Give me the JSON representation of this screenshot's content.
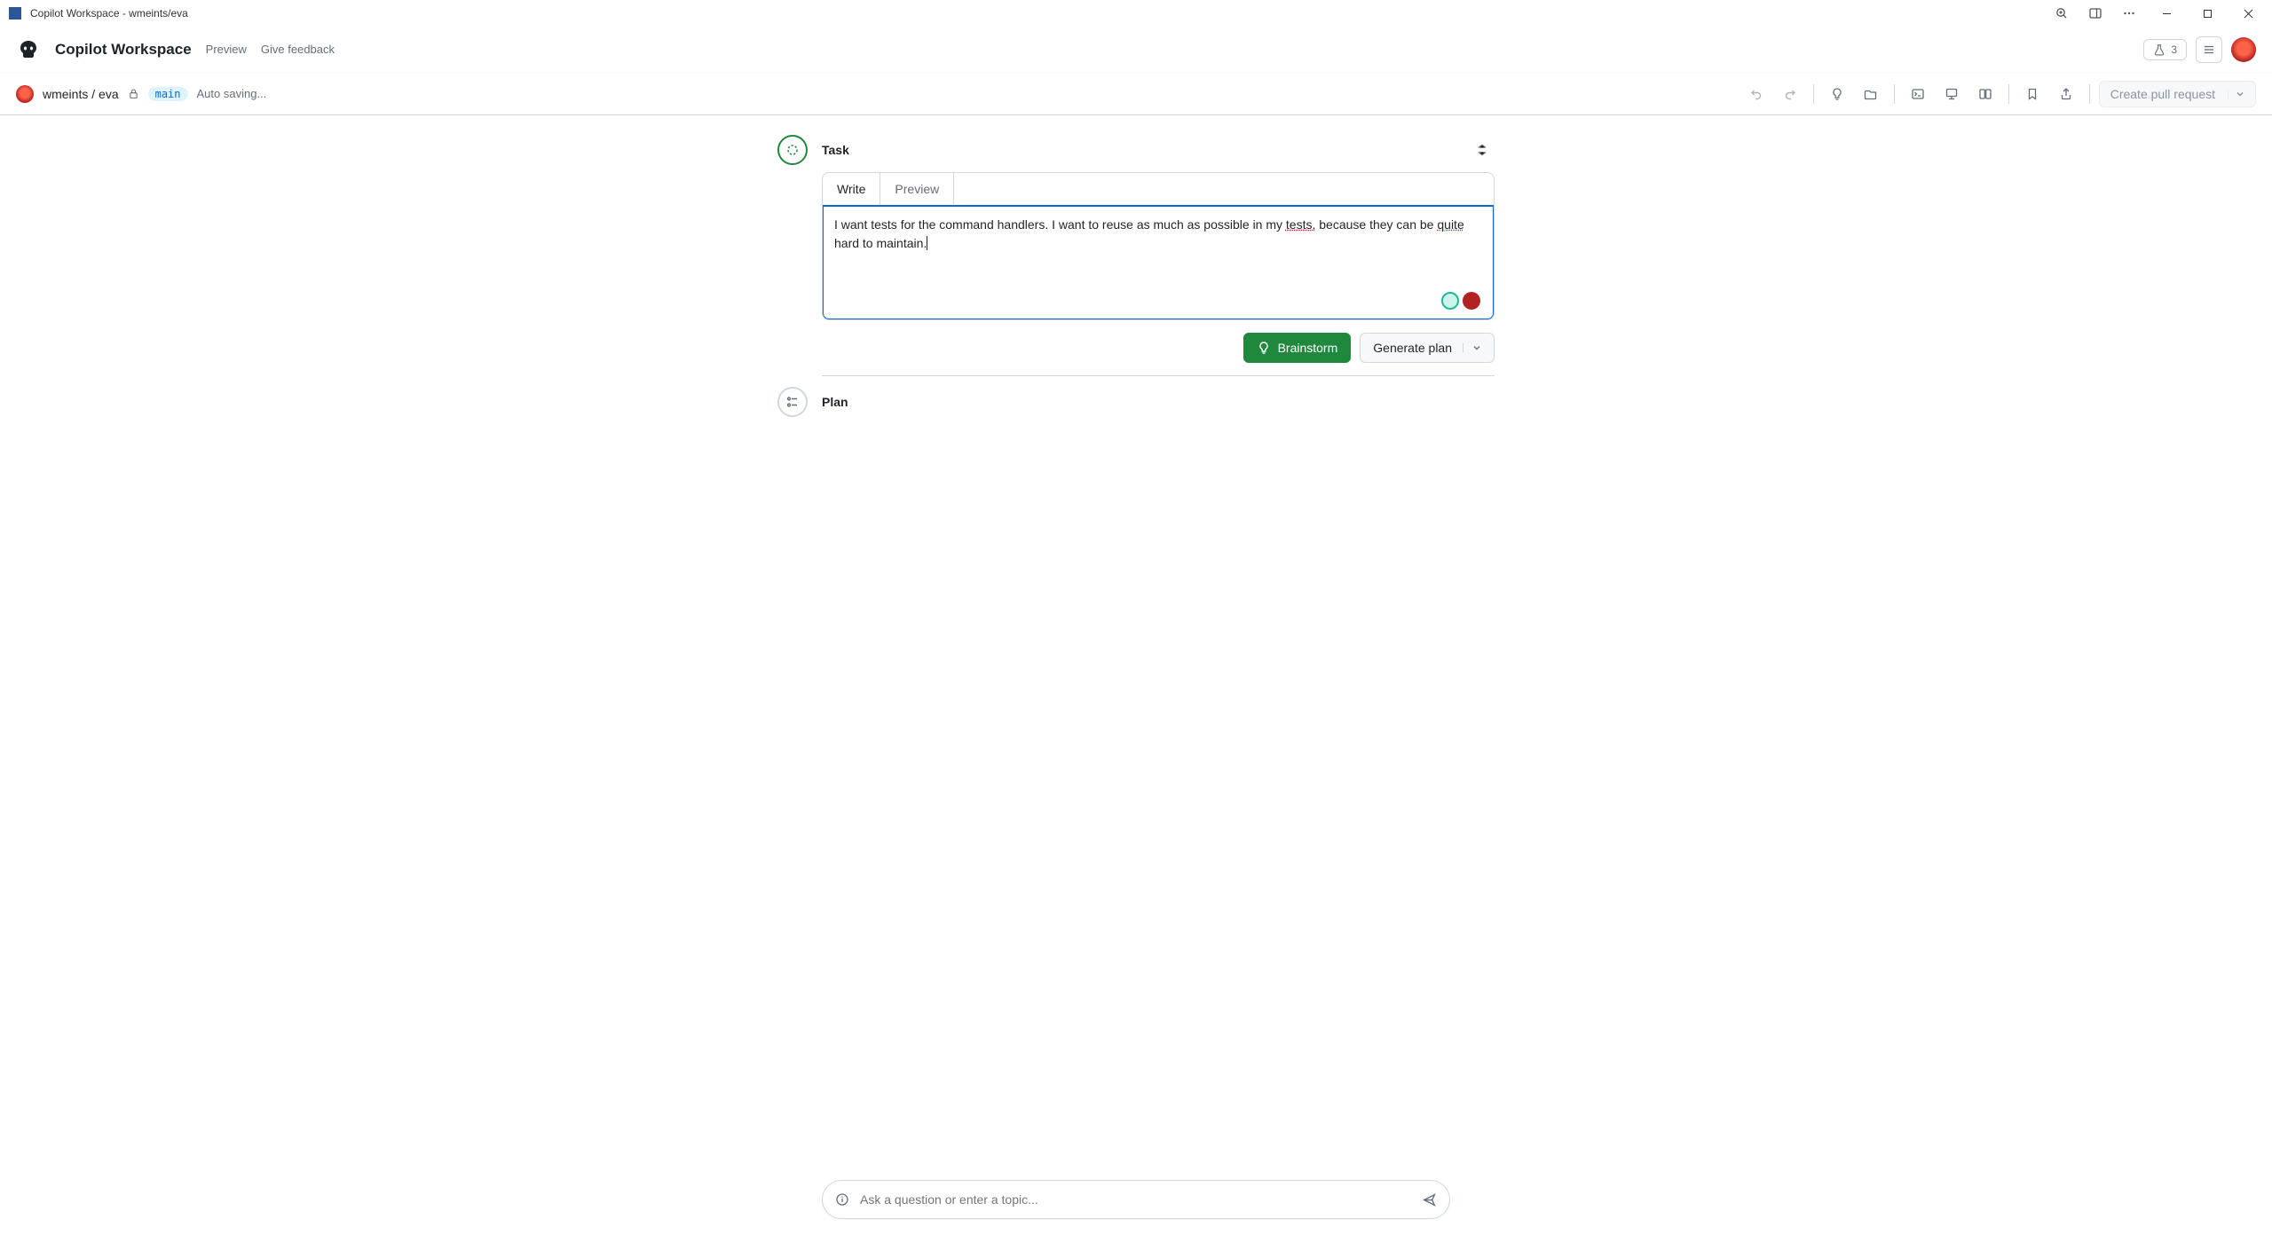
{
  "window": {
    "title": "Copilot Workspace - wmeints/eva"
  },
  "header": {
    "brand": "Copilot Workspace",
    "preview_label": "Preview",
    "feedback_label": "Give feedback",
    "experiment_count": "3"
  },
  "repo": {
    "owner": "wmeints",
    "separator": " / ",
    "name": "eva",
    "branch": "main",
    "save_status": "Auto saving...",
    "pull_request_label": "Create pull request"
  },
  "task": {
    "section_label": "Task",
    "tabs": {
      "write": "Write",
      "preview": "Preview"
    },
    "text_parts": {
      "a": "I want tests for the command handlers. I want to reuse as much as possible in my ",
      "b": "tests,",
      "c": " because they can be ",
      "d": "quite",
      "e": " hard to maintain."
    },
    "actions": {
      "brainstorm": "Brainstorm",
      "generate_plan": "Generate plan"
    }
  },
  "plan": {
    "section_label": "Plan"
  },
  "ask": {
    "placeholder": "Ask a question or enter a topic..."
  }
}
